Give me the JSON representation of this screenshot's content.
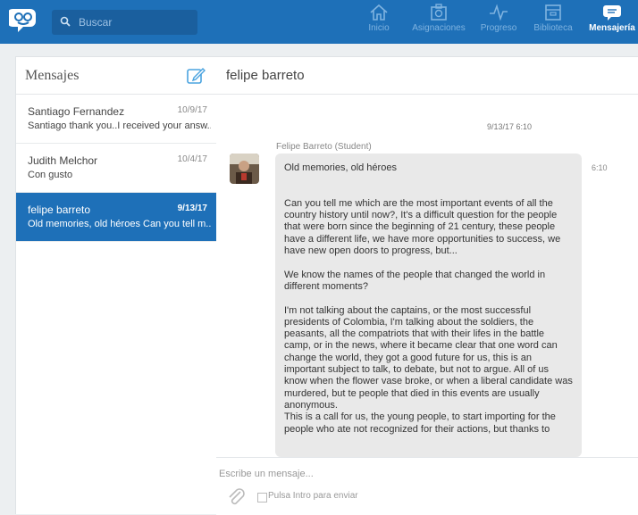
{
  "topbar": {
    "search_placeholder": "Buscar",
    "nav": [
      {
        "label": "Inicio",
        "icon": "home-icon"
      },
      {
        "label": "Asignaciones",
        "icon": "assignments-icon"
      },
      {
        "label": "Progreso",
        "icon": "progress-icon"
      },
      {
        "label": "Biblioteca",
        "icon": "library-icon"
      },
      {
        "label": "Mensajería",
        "icon": "messages-icon",
        "active": true
      }
    ]
  },
  "sidebar": {
    "title": "Mensajes",
    "conversations": [
      {
        "name": "Santiago Fernandez",
        "date": "10/9/17",
        "preview": "Santiago thank you..I received your answ..."
      },
      {
        "name": "Judith Melchor",
        "date": "10/4/17",
        "preview": "Con gusto"
      },
      {
        "name": "felipe barreto",
        "date": "9/13/17",
        "preview": "Old memories, old héroes Can you tell m...",
        "active": true
      }
    ]
  },
  "thread": {
    "title": "felipe barreto",
    "timestamp": "9/13/17 6:10",
    "sender": "Felipe Barreto (Student)",
    "message_time": "6:10",
    "message": "Old memories, old héroes\n\n\nCan you tell me which are the most important events of all the country history until now?, It's a difficult question for the people that were born since the beginning of 21 century, these people have a different life, we have more opportunities to success, we have new open doors to progress, but...\n\nWe know the names of the people that changed the world in different moments?\n\nI'm not talking about the captains, or the most successful presidents of Colombia, I'm talking about the soldiers, the peasants, all the compatriots that with their lifes in the battle camp, or in the news, where it became clear that one word can change the world, they got a good future for us, this is an important subject to talk, to debate, but not to argue. All of us know when the flower vase broke, or when a liberal candidate was murdered, but te people that died in this events are usually anonymous.\nThis is a call for us, the young people, to start importing for the people who ate not recognized for their actions, but thanks to",
    "composer_placeholder": "Escribe un mensaje...",
    "enter_to_send_label": "Pulsa Intro para enviar"
  },
  "colors": {
    "brand": "#1e70b8",
    "bubble": "#e9e9e9",
    "accent": "#4aa3df"
  }
}
